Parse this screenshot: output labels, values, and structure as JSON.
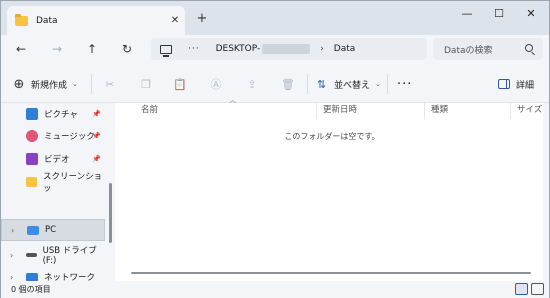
{
  "tab": {
    "title": "Data",
    "close": "✕"
  },
  "newtab": "+",
  "window_controls": {
    "minimize": "—",
    "maximize": "☐",
    "close": "✕"
  },
  "nav": {
    "back": "←",
    "forward": "→",
    "up": "↑",
    "refresh": "↻"
  },
  "address": {
    "more": "···",
    "pc": "DESKTOP-",
    "sep": "›",
    "folder": "Data"
  },
  "search": {
    "placeholder": "Dataの検索"
  },
  "toolbar": {
    "new_label": "新規作成",
    "new_chevron": "⌄",
    "sort_label": "並べ替え",
    "sort_chevron": "⌄",
    "more": "···",
    "details_label": "詳細",
    "disabled_icons": [
      "cut-icon",
      "copy-icon",
      "paste-icon",
      "rename-icon",
      "share-icon",
      "delete-icon"
    ]
  },
  "sidebar": {
    "items": [
      {
        "label": "ピクチャ",
        "icon": "pictures-icon",
        "color": "#2f7fd6",
        "pin": "📌"
      },
      {
        "label": "ミュージック",
        "icon": "music-icon",
        "color": "#e0557a",
        "pin": "📌"
      },
      {
        "label": "ビデオ",
        "icon": "video-icon",
        "color": "#8a3fc4",
        "pin": "📌"
      },
      {
        "label": "スクリーンショッ",
        "icon": "folder-icon",
        "color": "#f6c343"
      },
      {
        "label": "PC",
        "icon": "pc-icon",
        "color": "#3a8ee6"
      },
      {
        "label": "USB ドライブ (F:)",
        "icon": "usb-drive-icon",
        "color": "#555555"
      },
      {
        "label": "ネットワーク",
        "icon": "network-icon",
        "color": "#2f7fd6"
      }
    ]
  },
  "columns": [
    "名前",
    "更新日時",
    "種類",
    "サイズ"
  ],
  "empty_message": "このフォルダーは空です。",
  "status": {
    "text": "0 個の項目"
  }
}
